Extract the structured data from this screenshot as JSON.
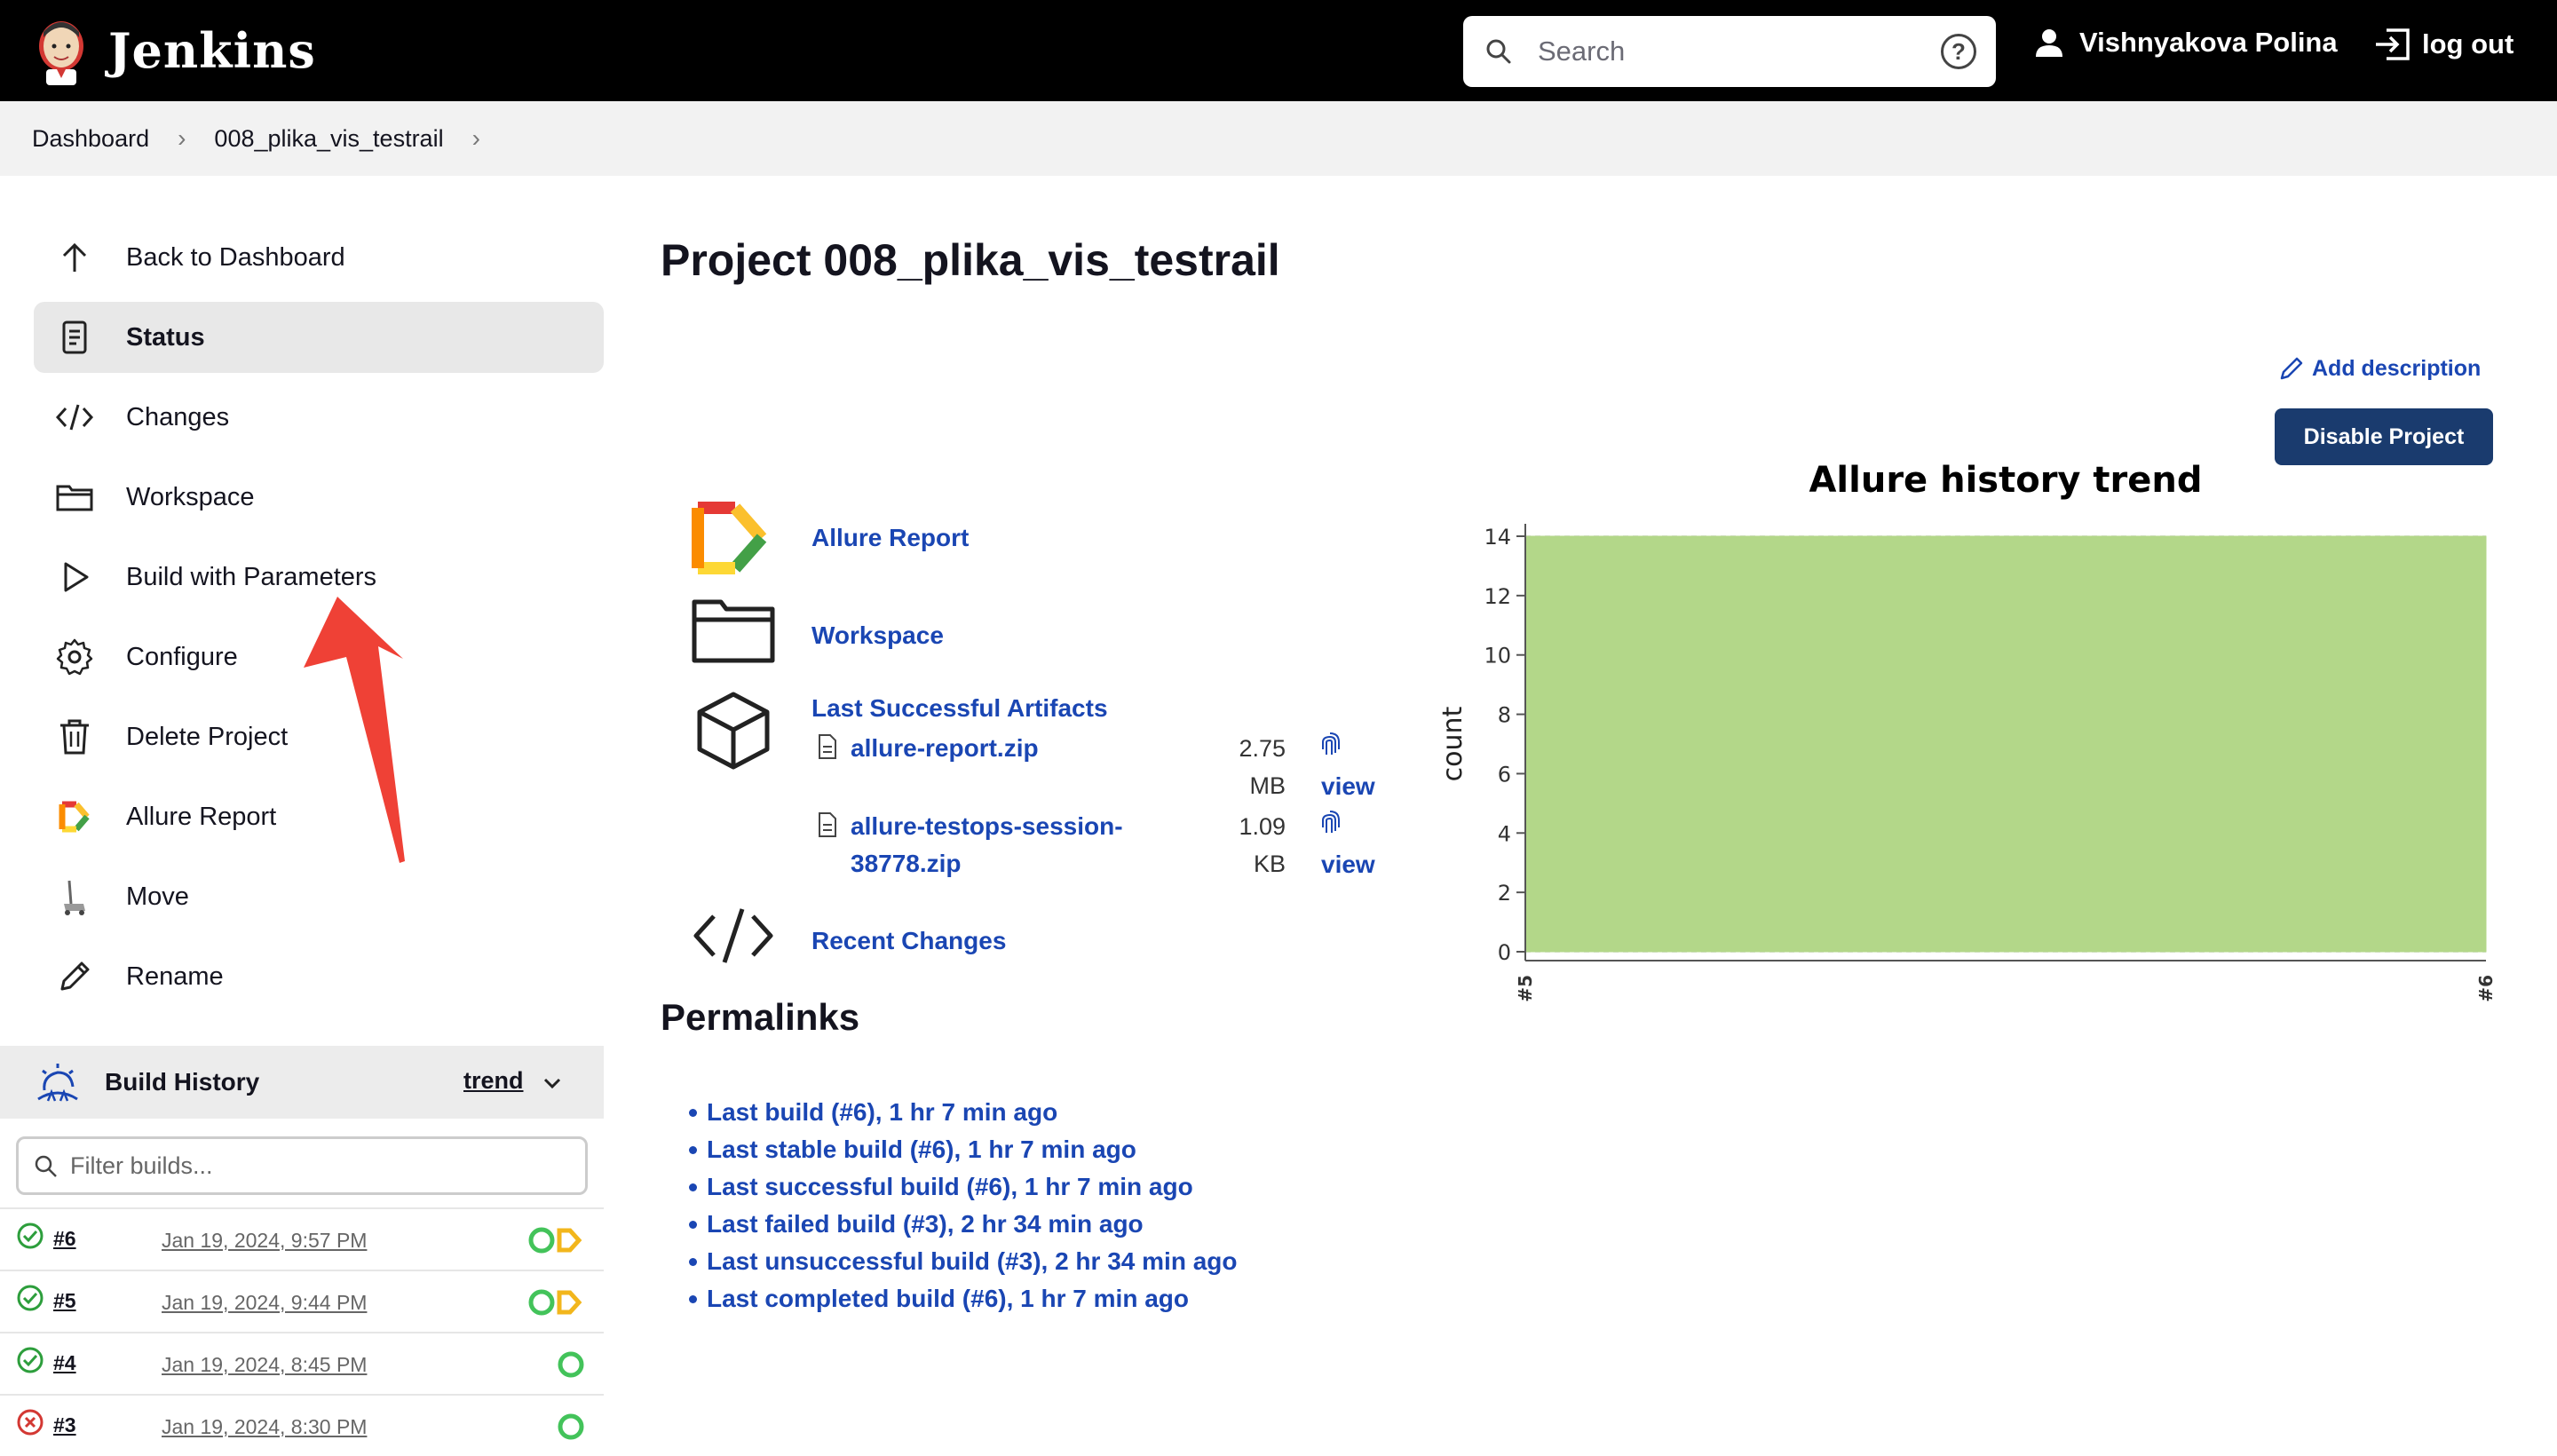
{
  "header": {
    "brand": "Jenkins",
    "search_placeholder": "Search",
    "help": "?",
    "user": "Vishnyakova Polina",
    "logout": "log out"
  },
  "breadcrumbs": [
    "Dashboard",
    "008_plika_vis_testrail"
  ],
  "sidebar": {
    "items": [
      {
        "label": "Back to Dashboard",
        "icon": "arrow-up-icon"
      },
      {
        "label": "Status",
        "icon": "document-icon",
        "active": true
      },
      {
        "label": "Changes",
        "icon": "code-icon"
      },
      {
        "label": "Workspace",
        "icon": "folder-icon"
      },
      {
        "label": "Build with Parameters",
        "icon": "play-icon"
      },
      {
        "label": "Configure",
        "icon": "gear-icon"
      },
      {
        "label": "Delete Project",
        "icon": "trash-icon"
      },
      {
        "label": "Allure Report",
        "icon": "allure-icon"
      },
      {
        "label": "Move",
        "icon": "move-icon"
      },
      {
        "label": "Rename",
        "icon": "pencil-icon"
      }
    ]
  },
  "build_history": {
    "title": "Build History",
    "trend_label": "trend",
    "filter_placeholder": "Filter builds...",
    "builds": [
      {
        "number": "#6",
        "date": "Jan 19, 2024, 9:57 PM",
        "status": "success"
      },
      {
        "number": "#5",
        "date": "Jan 19, 2024, 9:44 PM",
        "status": "success"
      },
      {
        "number": "#4",
        "date": "Jan 19, 2024, 8:45 PM",
        "status": "success"
      },
      {
        "number": "#3",
        "date": "Jan 19, 2024, 8:30 PM",
        "status": "failed"
      }
    ]
  },
  "main": {
    "title": "Project 008_plika_vis_testrail",
    "add_description": "Add description",
    "disable_button": "Disable Project",
    "links": {
      "allure": "Allure Report",
      "workspace": "Workspace",
      "artifacts": "Last Successful Artifacts",
      "recent": "Recent Changes"
    },
    "artifacts": [
      {
        "name_line1": "allure-report.zip",
        "name_line2": "",
        "size_value": "2.75",
        "size_unit": "MB",
        "view": "view"
      },
      {
        "name_line1": "allure-testops-session-",
        "name_line2": "38778.zip",
        "size_value": "1.09",
        "size_unit": "KB",
        "view": "view"
      }
    ],
    "permalinks_title": "Permalinks",
    "permalinks": [
      "Last build (#6), 1 hr 7 min ago",
      "Last stable build (#6), 1 hr 7 min ago",
      "Last successful build (#6), 1 hr 7 min ago",
      "Last failed build (#3), 2 hr 34 min ago",
      "Last unsuccessful build (#3), 2 hr 34 min ago",
      "Last completed build (#6), 1 hr 7 min ago"
    ]
  },
  "chart_data": {
    "type": "area",
    "title": "Allure history trend",
    "ylabel": "count",
    "xlabel": "",
    "categories": [
      "#5",
      "#6"
    ],
    "series": [
      {
        "values": [
          14,
          14
        ],
        "color": "#b3d789"
      }
    ],
    "ylim": [
      0,
      14
    ],
    "yticks": [
      0,
      2,
      4,
      6,
      8,
      10,
      12,
      14
    ],
    "grid": true
  },
  "colors": {
    "header_bg": "#000000",
    "link": "#1a46b3",
    "disable_button_bg": "#1a3b6e",
    "success": "#2d9e3c",
    "failed": "#d33833",
    "annotation_arrow": "#ef4136"
  }
}
